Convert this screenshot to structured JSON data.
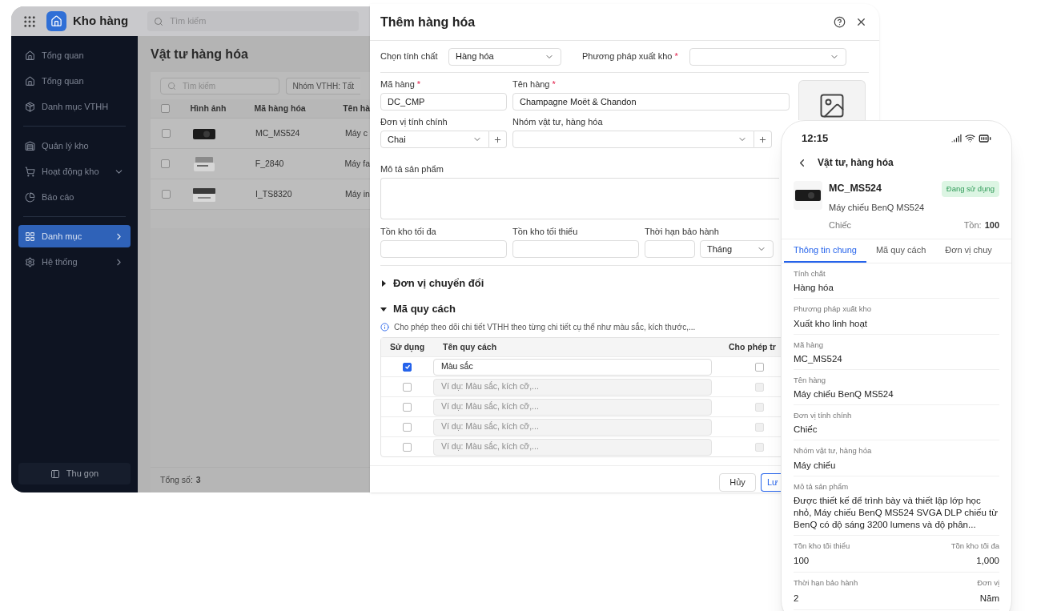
{
  "app": {
    "title": "Kho hàng",
    "search_placeholder": "Tìm kiếm",
    "sidebar_groups": [
      [
        {
          "label": "Tổng quan",
          "selected": false
        },
        {
          "label": "Tổng quan",
          "selected": false
        },
        {
          "label": "Danh mục VTHH",
          "selected": false
        }
      ],
      [
        {
          "label": "Quản lý kho",
          "selected": false
        },
        {
          "label": "Hoạt động kho",
          "selected": false,
          "has_dropdown": true
        },
        {
          "label": "Báo cáo",
          "selected": false
        }
      ],
      [
        {
          "label": "Danh mục",
          "selected": true,
          "has_flyout": true
        },
        {
          "label": "Hệ thống",
          "selected": false,
          "has_flyout": true
        }
      ]
    ],
    "collapse": "Thu gọn",
    "page_title": "Vật tư hàng hóa",
    "table_search_placeholder": "Tìm kiếm",
    "filter": "Nhóm VTHH: Tất",
    "select_all_checked": false,
    "columns": [
      "Hình ảnh",
      "Mã hàng hóa",
      "Tên hà"
    ],
    "rows": [
      {
        "checked": false,
        "code": "MC_MS524",
        "name": "Máy c"
      },
      {
        "checked": false,
        "code": "F_2840",
        "name": "Máy fa"
      },
      {
        "checked": false,
        "code": "I_TS8320",
        "name": "Máy in"
      }
    ],
    "total_label": "Tổng số:",
    "total": "3"
  },
  "dialog": {
    "title": "Thêm hàng hóa",
    "property": {
      "label": "Chọn tính chất",
      "value": "Hàng hóa"
    },
    "export_method": {
      "label": "Phương pháp xuất kho",
      "required_mark": "*"
    },
    "code": {
      "label": "Mã hàng",
      "required_mark": "*",
      "value": "DC_CMP"
    },
    "name": {
      "label": "Tên hàng",
      "required_mark": "*",
      "value": "Champagne Moët & Chandon"
    },
    "unit": {
      "label": "Đơn vị tính chính",
      "value": "Chai"
    },
    "group": {
      "label": "Nhóm vật tư, hàng hóa"
    },
    "description": {
      "label": "Mô tả sản phẩm"
    },
    "max_stock": {
      "label": "Tồn kho tối đa"
    },
    "min_stock": {
      "label": "Tồn kho tối thiểu"
    },
    "warranty": {
      "label": "Thời hạn bảo hành",
      "unit": "Tháng"
    },
    "sections": [
      {
        "title": "Đơn vị chuyển đổi",
        "expanded": false
      },
      {
        "title": "Mã quy cách",
        "expanded": true
      }
    ],
    "spec_info": "Cho phép theo dõi chi tiết VTHH theo từng chi tiết cụ thể như màu sắc, kích thước,...",
    "spec_columns": [
      "Sử dụng",
      "Tên quy cách",
      "Cho phép tr"
    ],
    "spec_rows": [
      {
        "used": true,
        "value": "Màu sắc",
        "allow": false,
        "disabled": false
      },
      {
        "used": false,
        "placeholder": "Ví dụ: Màu sắc, kích cỡ,...",
        "allow": false,
        "disabled": true
      },
      {
        "used": false,
        "placeholder": "Ví dụ: Màu sắc, kích cỡ,...",
        "allow": false,
        "disabled": true
      },
      {
        "used": false,
        "placeholder": "Ví dụ: Màu sắc, kích cỡ,...",
        "allow": false,
        "disabled": true
      },
      {
        "used": false,
        "placeholder": "Ví dụ: Màu sắc, kích cỡ,...",
        "allow": false,
        "disabled": true
      }
    ],
    "buttons": [
      {
        "label": "Hủy",
        "kind": "secondary"
      },
      {
        "label": "Lư",
        "kind": "primary"
      }
    ]
  },
  "phone": {
    "time": "12:15",
    "title": "Vật tư, hàng hóa",
    "product": {
      "code": "MC_MS524",
      "status": "Đang sử dụng",
      "name": "Máy chiếu BenQ MS524",
      "unit": "Chiếc",
      "stock_label": "Tồn:",
      "stock": "100"
    },
    "tabs": [
      {
        "label": "Thông tin chung",
        "selected": true
      },
      {
        "label": "Mã quy cách",
        "selected": false
      },
      {
        "label": "Đơn vị chuy",
        "selected": false
      }
    ],
    "fields": [
      {
        "label": "Tính chất",
        "value": "Hàng hóa"
      },
      {
        "label": "Phương pháp xuất kho",
        "value": "Xuất kho linh hoạt"
      },
      {
        "label": "Mã hàng",
        "value": "MC_MS524"
      },
      {
        "label": "Tên hàng",
        "value": "Máy chiếu BenQ MS524"
      },
      {
        "label": "Đơn vị tính chính",
        "value": "Chiếc"
      },
      {
        "label": "Nhóm vật tư, hàng hóa",
        "value": "Máy chiếu"
      },
      {
        "label": "Mô tả sản phẩm",
        "value": "Được thiết kế để trình bày và thiết lập lớp học nhỏ, Máy chiếu BenQ MS524 SVGA DLP chiếu từ BenQ có độ sáng 3200 lumens và độ phân..."
      }
    ],
    "pairs": [
      {
        "left_label": "Tồn kho tối thiểu",
        "left_value": "100",
        "right_label": "Tồn kho tối đa",
        "right_value": "1,000"
      },
      {
        "left_label": "Thời hạn bảo hành",
        "left_value": "2",
        "right_label": "Đơn vị",
        "right_value": "Năm"
      }
    ]
  }
}
